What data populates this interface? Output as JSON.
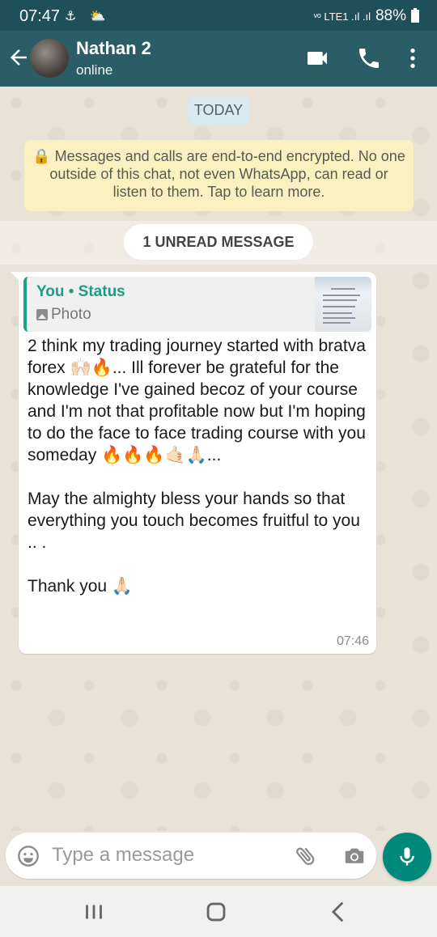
{
  "status_bar": {
    "time": "07:47",
    "left_icons": "⚓ ⛅",
    "network": "ᵛᵒ LTE1 .ıl .ıl",
    "battery": "88%"
  },
  "header": {
    "contact_name": "Nathan 2",
    "contact_status": "online",
    "icons": [
      "back-arrow-icon",
      "video-call-icon",
      "phone-call-icon",
      "more-options-icon"
    ]
  },
  "chat": {
    "date_chip": "TODAY",
    "encryption_notice": "🔒 Messages and calls are end-to-end encrypted. No one outside of this chat, not even WhatsApp, can read or listen to them. Tap to learn more.",
    "unread_label": "1 UNREAD MESSAGE",
    "message": {
      "quote_author": "You • Status",
      "quote_type": "Photo",
      "text": "2 think my trading journey started with bratva forex 🙌🏻🔥... Ill forever be grateful for the knowledge I've gained becoz of your course and I'm not that profitable now but I'm hoping to do the face to face trading course with you someday 🔥🔥🔥🤙🏻🙏🏻...\n\nMay the almighty bless your hands so that everything you touch becomes fruitful to you .. .\n\nThank you 🙏🏻",
      "time": "07:46"
    }
  },
  "composer": {
    "placeholder": "Type a message"
  },
  "colors": {
    "header": "#2b5d66",
    "accent": "#00897b",
    "encryption_bg": "#fbf1c0"
  }
}
